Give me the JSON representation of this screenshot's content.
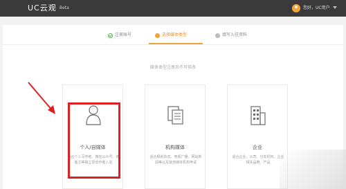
{
  "header": {
    "logo": "UC云观",
    "beta": "Beta",
    "user_name": "您好，UC用户"
  },
  "steps": [
    {
      "label": "注册账号",
      "state": "done"
    },
    {
      "label": "选择媒体类型",
      "state": "active"
    },
    {
      "label": "填写入驻资料",
      "state": "todo"
    }
  ],
  "hint": "媒体类型注册后不可修改",
  "media_types": [
    {
      "title": "个人/自媒体",
      "desc": "适合个人写作者、微信公众号、博客主等独立原创作者入驻",
      "icon": "person-icon"
    },
    {
      "title": "机构媒体",
      "desc": "适合报纸杂志、电视广播、网站新闻等以及其他媒体机构申请",
      "icon": "document-icon"
    },
    {
      "title": "企业",
      "desc": "适合企业、公司、分支机构、企业相关品牌、产品",
      "icon": "building-icon"
    }
  ],
  "colors": {
    "accent": "#f0a23a",
    "highlight": "#e02020",
    "topbar": "#3a3a3a"
  }
}
